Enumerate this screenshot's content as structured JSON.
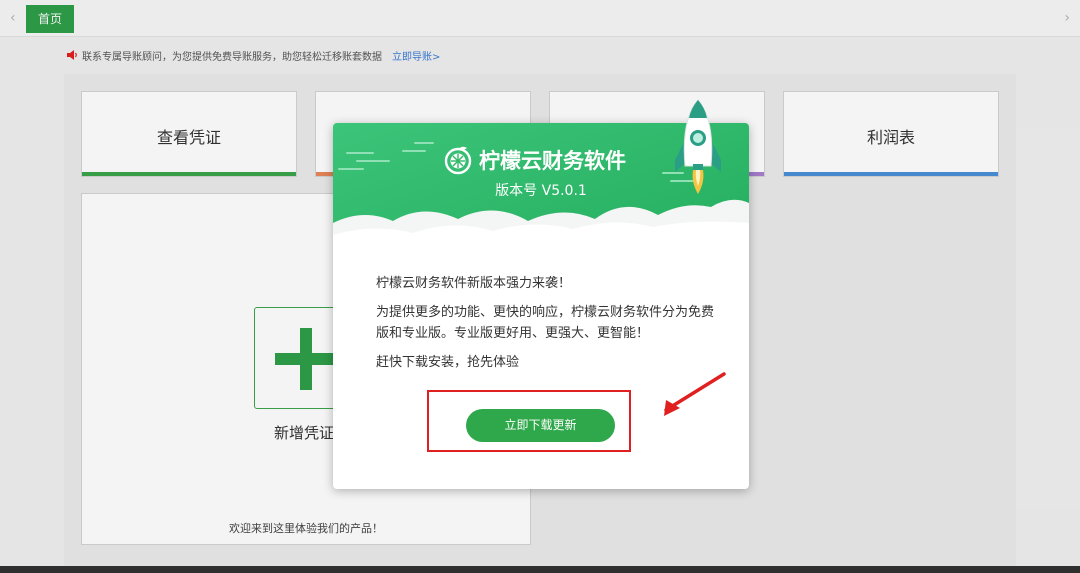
{
  "tabbar": {
    "home_tab": "首页",
    "left_arrow": "‹",
    "right_arrow": "›"
  },
  "notice": {
    "text": "联系专属导账顾问，为您提供免费导账服务，助您轻松迁移账套数据",
    "link": "立即导账>"
  },
  "cards": [
    {
      "label": "查看凭证",
      "color": "#3aa64b"
    },
    {
      "label": "",
      "color": "#e8875a"
    },
    {
      "label": "",
      "color": "#a97fd0"
    },
    {
      "label": "利润表",
      "color": "#4a90d9"
    }
  ],
  "new_voucher": {
    "label": "新增凭证",
    "welcome": "欢迎来到这里体验我们的产品！"
  },
  "modal": {
    "title": "柠檬云财务软件",
    "version": "版本号 V5.0.1",
    "line1": "柠檬云财务软件新版本强力来袭！",
    "line2": "为提供更多的功能、更快的响应，柠檬云财务软件分为免费版和专业版。专业版更好用、更强大、更智能！",
    "line3": "赶快下载安装，抢先体验",
    "button": "立即下载更新"
  },
  "colors": {
    "brand_green": "#2e9e49",
    "header_green_light": "#3cc47a",
    "header_green_dark": "#27b163",
    "annotation_red": "#e02020",
    "link_blue": "#3a7bd5"
  }
}
